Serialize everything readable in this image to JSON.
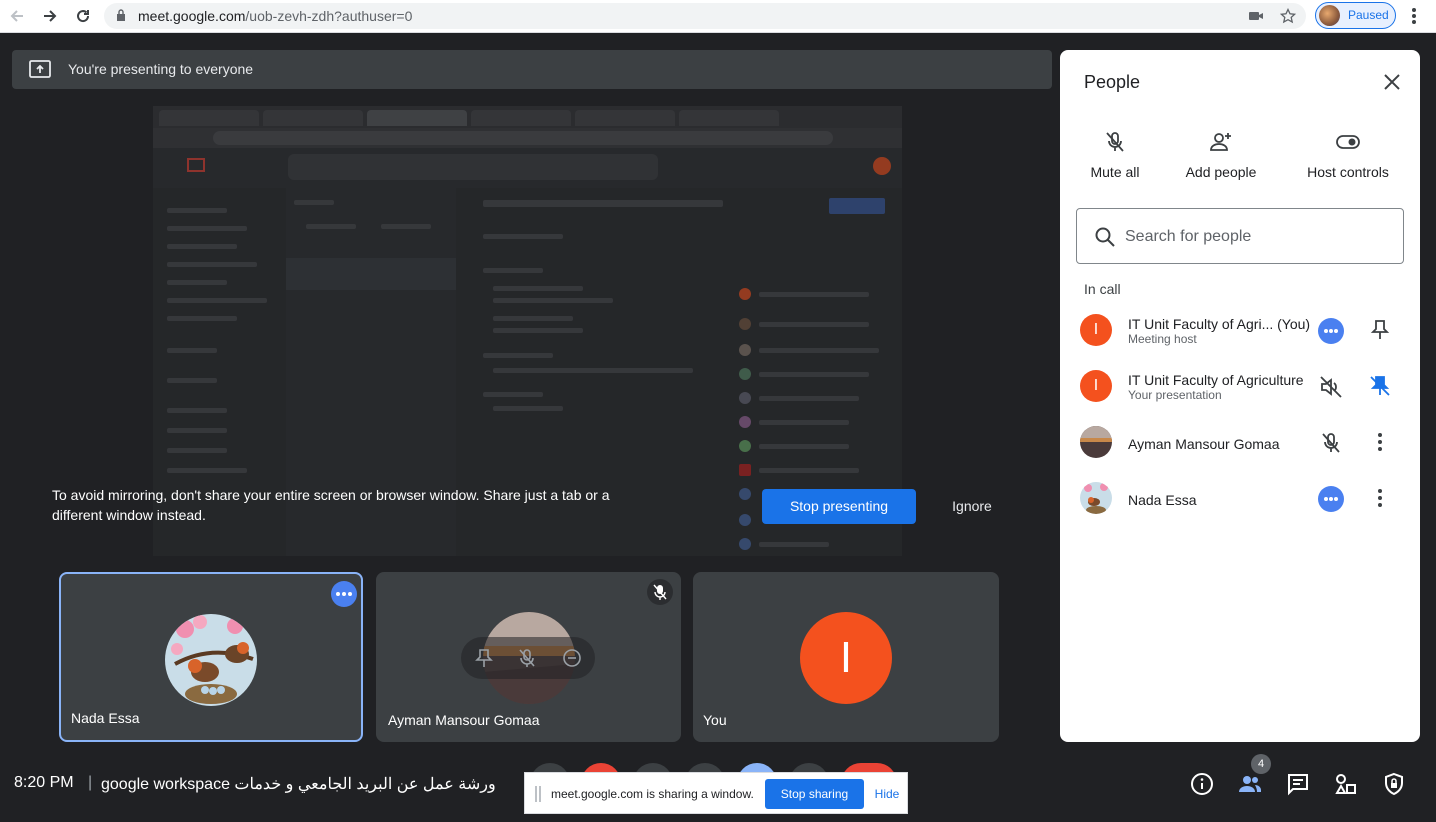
{
  "browser": {
    "url_host": "meet.google.com",
    "url_path": "/uob-zevh-zdh?authuser=0",
    "profile_status": "Paused"
  },
  "banner": {
    "text": "You're presenting to everyone"
  },
  "warning": {
    "text": "To avoid mirroring, don't share your entire screen or browser window. Share just a tab or a different window instead.",
    "stop_label": "Stop presenting",
    "ignore_label": "Ignore"
  },
  "tiles": [
    {
      "name": "Nada Essa"
    },
    {
      "name": "Ayman Mansour Gomaa"
    },
    {
      "name": "You",
      "initial": "I"
    }
  ],
  "bottom": {
    "time": "8:20 PM",
    "separator": "|",
    "meeting_title": "google workspace ورشة عمل عن البريد الجامعي و خدمات",
    "people_count": "4"
  },
  "share_notice": {
    "text": "meet.google.com is sharing a window.",
    "stop_label": "Stop sharing",
    "hide_label": "Hide"
  },
  "people_panel": {
    "title": "People",
    "actions": [
      {
        "label": "Mute all",
        "icon": "mic-off-icon"
      },
      {
        "label": "Add people",
        "icon": "person-add-icon"
      },
      {
        "label": "Host controls",
        "icon": "toggle-icon"
      }
    ],
    "search_placeholder": "Search for people",
    "section_label": "In call",
    "participants": [
      {
        "name": "IT Unit Faculty of Agri...",
        "suffix": "(You)",
        "subtitle": "Meeting host",
        "initial": "I"
      },
      {
        "name": "IT Unit Faculty of Agriculture",
        "subtitle": "Your presentation",
        "initial": "I"
      },
      {
        "name": "Ayman Mansour Gomaa"
      },
      {
        "name": "Nada Essa"
      }
    ]
  },
  "colors": {
    "accent": "#1a73e8",
    "avatar_orange": "#f4511e",
    "meet_bg": "#202124"
  }
}
